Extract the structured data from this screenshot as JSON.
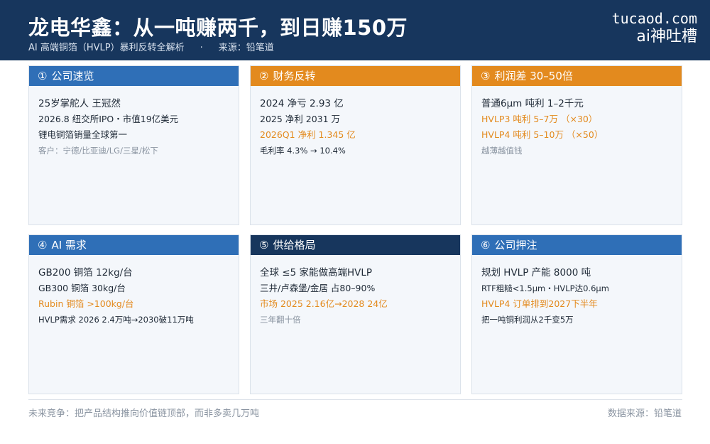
{
  "header": {
    "title": "龙电华鑫：从一吨赚两千，到日赚150万",
    "subtitle_topic": "AI 高端铜箔（HVLP）暴利反转全解析",
    "subtitle_sep": "·",
    "subtitle_source": "来源：铅笔道",
    "brand_domain": "tucaod.com",
    "brand_name": "ai神吐槽"
  },
  "cards": [
    {
      "num": "①",
      "title": "公司速览",
      "head_color": "#2f6fb7",
      "lines": [
        "25岁掌舵人 王冠然",
        "2026.8 纽交所IPO・市值19亿美元",
        "锂电铜箔销量全球第一",
        "客户：宁德/比亚迪/LG/三星/松下"
      ]
    },
    {
      "num": "②",
      "title": "财务反转",
      "head_color": "#e38a1e",
      "lines": [
        "2024 净亏 2.93 亿",
        "2025 净利 2031 万",
        "2026Q1 净利 1.345 亿",
        "毛利率 4.3% → 10.4%"
      ]
    },
    {
      "num": "③",
      "title": "利润差 30–50倍",
      "head_color": "#e38a1e",
      "lines": [
        "普通6μm 吨利 1–2千元",
        "HVLP3 吨利 5–7万 （×30）",
        "HVLP4 吨利 5–10万 （×50）",
        "越薄越值钱"
      ]
    },
    {
      "num": "④",
      "title": "AI 需求",
      "head_color": "#2f6fb7",
      "lines": [
        "GB200 铜箔 12kg/台",
        "GB300 铜箔 30kg/台",
        "Rubin 铜箔 >100kg/台",
        "HVLP需求 2026 2.4万吨→2030破11万吨"
      ]
    },
    {
      "num": "⑤",
      "title": "供给格局",
      "head_color": "#17365d",
      "lines": [
        "全球 ≤5 家能做高端HVLP",
        "三井/卢森堡/金居 占80–90%",
        "市场 2025 2.16亿→2028 24亿",
        "三年翻十倍"
      ]
    },
    {
      "num": "⑥",
      "title": "公司押注",
      "head_color": "#2f6fb7",
      "lines": [
        "规划 HVLP 产能 8000 吨",
        "RTF粗糙<1.5μm・HVLP达0.6μm",
        "HVLP4 订单排到2027下半年",
        "把一吨铜利润从2千变5万"
      ]
    }
  ],
  "footer": {
    "left": "未来竞争：把产品结构推向价值链顶部，而非多卖几万吨",
    "right": "数据来源：铅笔道"
  },
  "colors": {
    "navy": "#17365d",
    "blue": "#2f6fb7",
    "orange": "#e38a1e",
    "muted": "#8a94a1",
    "card_bg": "#f4f7fb"
  }
}
